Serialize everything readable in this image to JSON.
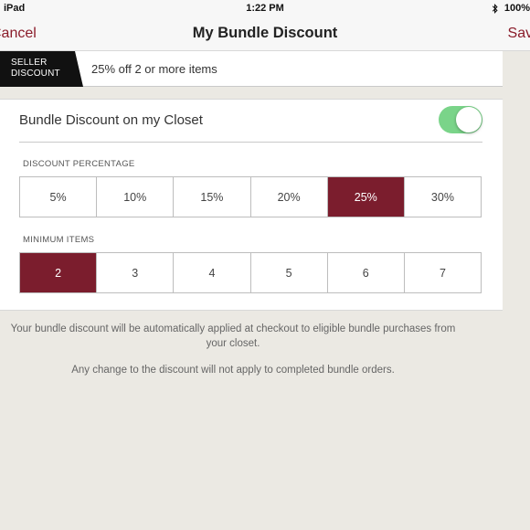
{
  "status_bar": {
    "device": "iPad",
    "time": "1:22 PM",
    "battery": "100%"
  },
  "nav": {
    "cancel_label": "Cancel",
    "title": "My Bundle Discount",
    "save_label": "Save"
  },
  "banner": {
    "tag_line1": "SELLER",
    "tag_line2": "DISCOUNT",
    "summary": "25% off 2 or more items"
  },
  "bundle_toggle": {
    "label": "Bundle Discount on my Closet",
    "enabled": true,
    "on_color": "#7ad489"
  },
  "discount_percentage": {
    "header": "DISCOUNT PERCENTAGE",
    "options": [
      "5%",
      "10%",
      "15%",
      "20%",
      "25%",
      "30%"
    ],
    "selected": "25%"
  },
  "minimum_items": {
    "header": "MINIMUM ITEMS",
    "options": [
      "2",
      "3",
      "4",
      "5",
      "6",
      "7"
    ],
    "selected": "2"
  },
  "notes": {
    "line1": "Your bundle discount will be automatically applied at checkout to eligible bundle purchases from your closet.",
    "line2": "Any change to the discount will not apply to completed bundle orders."
  },
  "colors": {
    "accent": "#7b1d2d",
    "nav_link": "#8a1c2a",
    "background": "#ebe9e3"
  }
}
